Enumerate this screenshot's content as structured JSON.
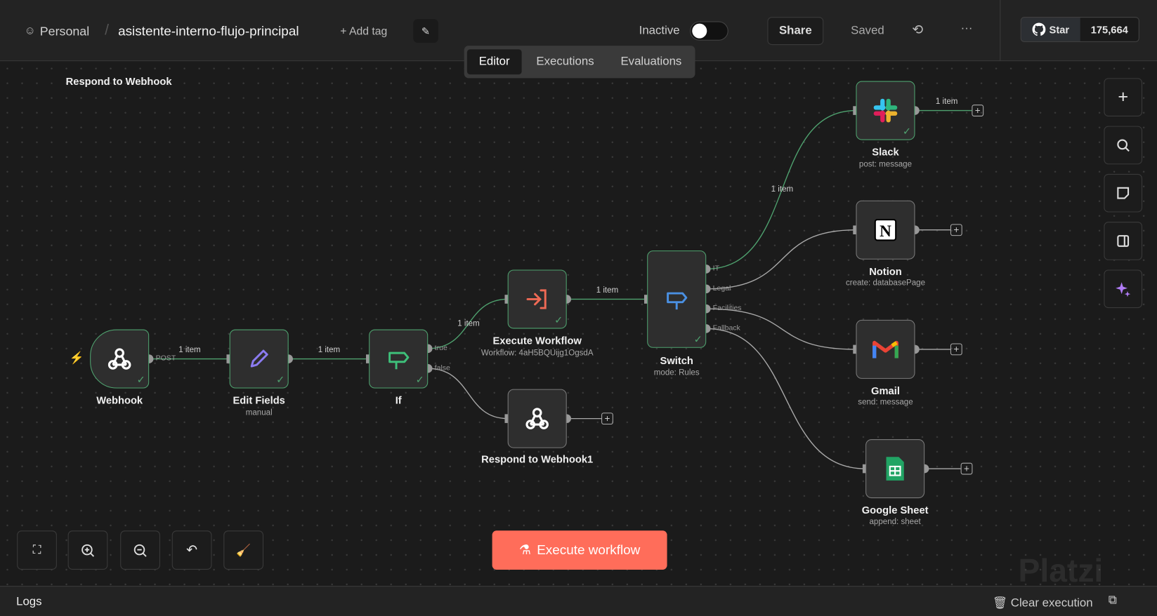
{
  "header": {
    "workspace": "Personal",
    "workflow_name": "asistente-interno-flujo-principal",
    "add_tag": "+ Add tag",
    "status_label": "Inactive",
    "active": false,
    "share": "Share",
    "saved": "Saved",
    "github_star": "Star",
    "github_count": "175,664"
  },
  "tabs": [
    {
      "label": "Editor",
      "active": true
    },
    {
      "label": "Executions"
    },
    {
      "label": "Evaluations"
    }
  ],
  "nodes": {
    "respond_top": {
      "label": "Respond to Webhook"
    },
    "webhook": {
      "label": "Webhook",
      "port": "POST"
    },
    "edit": {
      "label": "Edit Fields",
      "sub": "manual"
    },
    "if": {
      "label": "If",
      "true": "true",
      "false": "false"
    },
    "exec": {
      "label": "Execute Workflow",
      "sub": "Workflow: 4aH5BQUijg1OgsdA"
    },
    "respond1": {
      "label": "Respond to Webhook1"
    },
    "switch": {
      "label": "Switch",
      "sub": "mode: Rules",
      "outputs": [
        "IT",
        "Legal",
        "Facilities",
        "Fallback"
      ]
    },
    "slack": {
      "label": "Slack",
      "sub": "post: message"
    },
    "notion": {
      "label": "Notion",
      "sub": "create: databasePage"
    },
    "gmail": {
      "label": "Gmail",
      "sub": "send: message"
    },
    "sheet": {
      "label": "Google Sheet",
      "sub": "append: sheet"
    }
  },
  "edges": {
    "items": "1 item"
  },
  "colors": {
    "accent": "#ff6d5a",
    "success": "#4fa26f"
  },
  "execute_button": "Execute workflow",
  "logs": {
    "title": "Logs",
    "clear": "Clear execution"
  },
  "watermark": "Platzi"
}
